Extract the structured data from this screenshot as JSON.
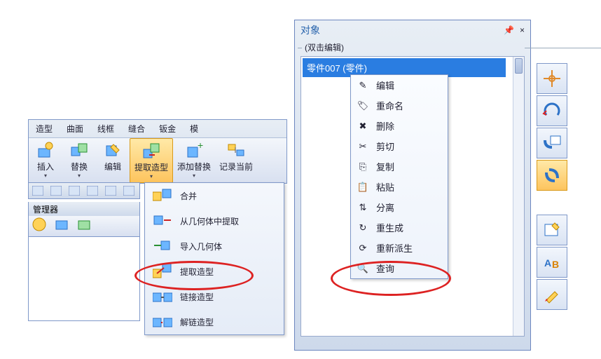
{
  "ribbon": {
    "tabs": [
      "造型",
      "曲面",
      "线框",
      "缝合",
      "钣金",
      "模"
    ],
    "buttons": {
      "insert": "插入",
      "replace": "替换",
      "edit": "编辑",
      "extract_shape": "提取造型",
      "add_replace": "添加替换",
      "record_current": "记录当前"
    }
  },
  "manager": {
    "label": "管理器"
  },
  "dropdown": {
    "items": [
      {
        "id": "merge",
        "label": "合并"
      },
      {
        "id": "extract-from-geom",
        "label": "从几何体中提取"
      },
      {
        "id": "import-geom",
        "label": "导入几何体"
      },
      {
        "id": "extract-shape",
        "label": "提取造型"
      },
      {
        "id": "link-shape",
        "label": "链接造型"
      },
      {
        "id": "unlink-shape",
        "label": "解链造型"
      }
    ]
  },
  "panel": {
    "title": "对象",
    "group": "(双击编辑)",
    "node": "零件007 (零件)",
    "pin": "📌",
    "close": "×"
  },
  "ctx": {
    "items": [
      {
        "id": "edit",
        "label": "编辑"
      },
      {
        "id": "rename",
        "label": "重命名"
      },
      {
        "id": "delete",
        "label": "删除"
      },
      {
        "id": "cut",
        "label": "剪切"
      },
      {
        "id": "copy",
        "label": "复制"
      },
      {
        "id": "paste",
        "label": "粘贴"
      },
      {
        "id": "separate",
        "label": "分离"
      },
      {
        "id": "regenerate",
        "label": "重生成"
      },
      {
        "id": "redevelop",
        "label": "重新派生"
      },
      {
        "id": "query",
        "label": "查询"
      }
    ]
  },
  "vtoolbar": {
    "items": [
      {
        "id": "snap",
        "name": "snap-icon",
        "sel": false
      },
      {
        "id": "rotate",
        "name": "rotate-icon",
        "sel": false
      },
      {
        "id": "link-table",
        "name": "link-table-icon",
        "sel": false
      },
      {
        "id": "link",
        "name": "link-icon",
        "sel": true
      },
      {
        "id": "note",
        "name": "note-icon",
        "sel": false
      },
      {
        "id": "rename-tool",
        "name": "rename-tool-icon",
        "sel": false
      },
      {
        "id": "highlight",
        "name": "highlight-icon",
        "sel": false
      }
    ]
  }
}
